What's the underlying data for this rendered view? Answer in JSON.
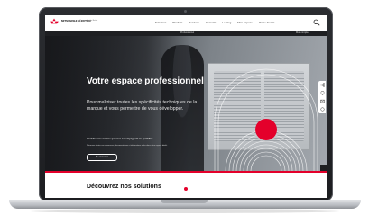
{
  "header": {
    "logo_text": "MITSUBISHI ELECTRIC",
    "logo_sub": "Changes for the Better",
    "nav": [
      "Solutions",
      "Produits",
      "Services",
      "Conseils",
      "Le blog",
      "Mon Espace",
      "Où se fournir"
    ]
  },
  "sub_bar": {
    "pro_label": "Professionnel",
    "account_label": "Mon compte"
  },
  "hero": {
    "title": "Votre espace professionnel",
    "lead": "Pour maîtriser toutes les spécificités techniques de la marque et vous permettre de vous développer.",
    "cta_title": "Accédez aux services qui vous accompagnent au quotidien.",
    "cta_text": "Retrouvez toutes vos ressources, documentations et informations utiles dans votre espace dédié.",
    "cta_button": "Se connecter"
  },
  "section": {
    "title": "Découvrez nos solutions"
  },
  "colors": {
    "accent_red": "#e4002b",
    "dark": "#1e1f22"
  }
}
